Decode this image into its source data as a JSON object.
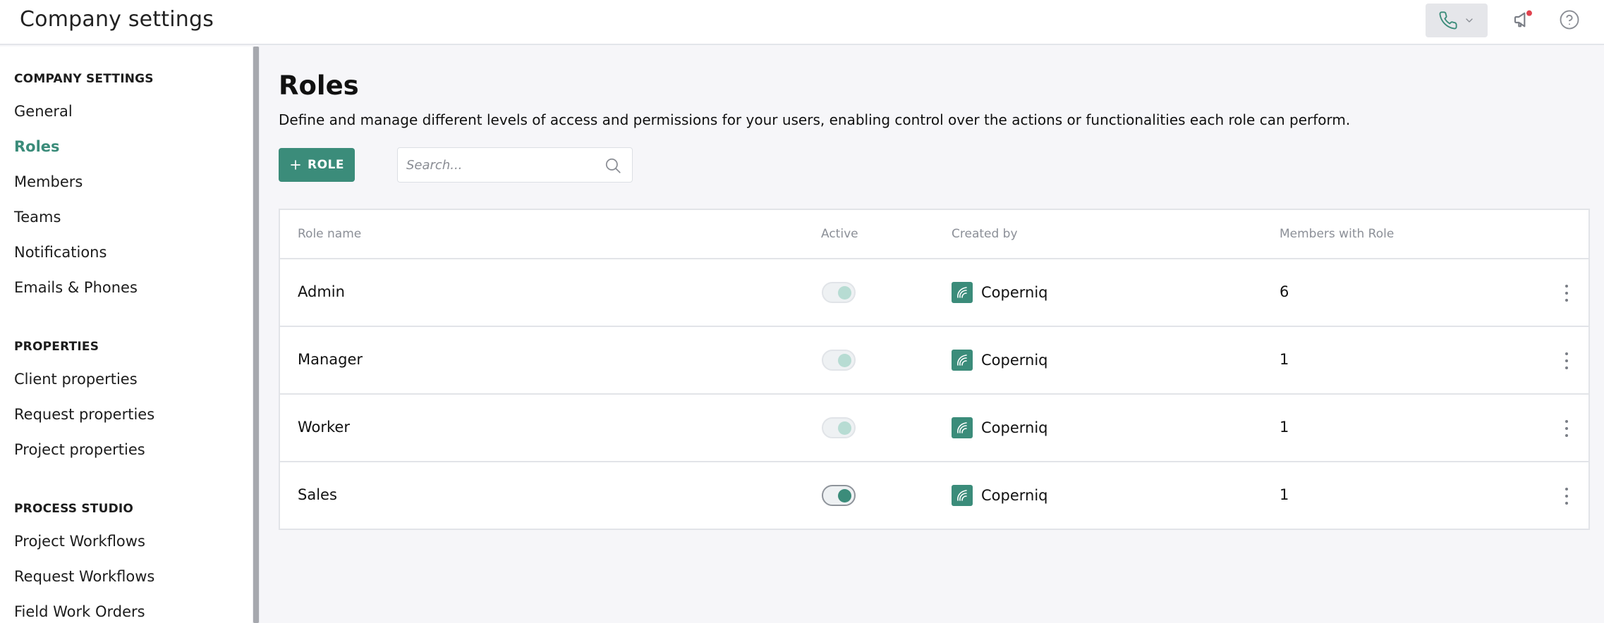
{
  "header": {
    "title": "Company settings"
  },
  "sidebar": {
    "sections": [
      {
        "title": "COMPANY SETTINGS",
        "items": [
          "General",
          "Roles",
          "Members",
          "Teams",
          "Notifications",
          "Emails & Phones"
        ]
      },
      {
        "title": "PROPERTIES",
        "items": [
          "Client properties",
          "Request properties",
          "Project properties"
        ]
      },
      {
        "title": "PROCESS STUDIO",
        "items": [
          "Project Workflows",
          "Request Workflows",
          "Field Work Orders"
        ]
      }
    ],
    "active_item": "Roles"
  },
  "main": {
    "title": "Roles",
    "description": "Define and manage different levels of access and permissions for your users, enabling control over the actions or functionalities each role can perform.",
    "add_button_label": "ROLE",
    "search_placeholder": "Search...",
    "table": {
      "columns": [
        "Role name",
        "Active",
        "Created by",
        "Members with Role"
      ],
      "rows": [
        {
          "name": "Admin",
          "active": true,
          "active_disabled": true,
          "created_by": "Coperniq",
          "members": "6"
        },
        {
          "name": "Manager",
          "active": true,
          "active_disabled": true,
          "created_by": "Coperniq",
          "members": "1"
        },
        {
          "name": "Worker",
          "active": true,
          "active_disabled": true,
          "created_by": "Coperniq",
          "members": "1"
        },
        {
          "name": "Sales",
          "active": true,
          "active_disabled": false,
          "created_by": "Coperniq",
          "members": "1"
        }
      ]
    }
  },
  "colors": {
    "accent": "#3b8c7a",
    "accent_light": "#b7dcd3",
    "notification_dot": "#e0434f"
  },
  "icons": {
    "phone": "phone-icon",
    "chevron": "chevron-down-icon",
    "announce": "megaphone-icon",
    "help": "help-circle-icon",
    "plus": "plus-icon",
    "search": "search-icon",
    "kebab": "more-vertical-icon",
    "creator_logo": "coperniq-logo-icon"
  }
}
